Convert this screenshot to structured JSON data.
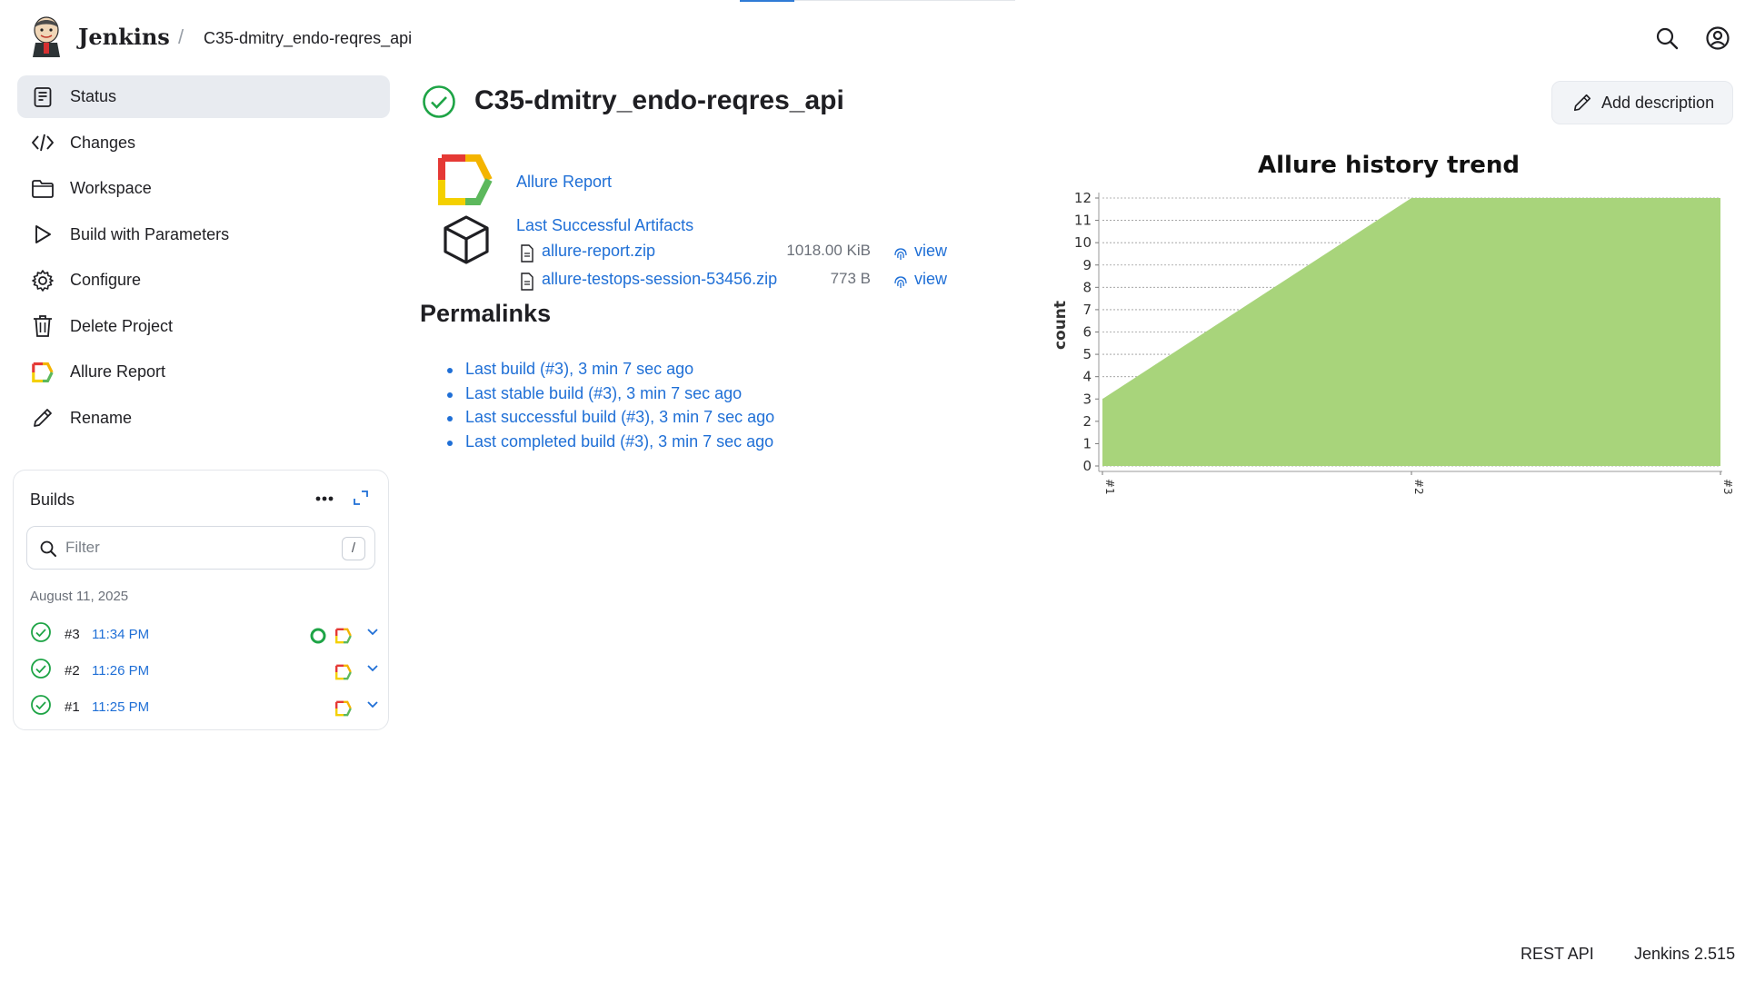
{
  "header": {
    "brand": "Jenkins",
    "breadcrumb_separator": "/",
    "breadcrumb_job": "C35-dmitry_endo-reqres_api",
    "icons": [
      "search-icon",
      "user-icon"
    ]
  },
  "sidebar": {
    "items": [
      {
        "label": "Status",
        "icon": "status-icon",
        "active": true
      },
      {
        "label": "Changes",
        "icon": "code-icon"
      },
      {
        "label": "Workspace",
        "icon": "folder-icon"
      },
      {
        "label": "Build with Parameters",
        "icon": "play-icon"
      },
      {
        "label": "Configure",
        "icon": "gear-icon"
      },
      {
        "label": "Delete Project",
        "icon": "trash-icon"
      },
      {
        "label": "Allure Report",
        "icon": "allure-icon"
      },
      {
        "label": "Rename",
        "icon": "pencil-icon"
      }
    ]
  },
  "builds": {
    "title": "Builds",
    "filter_placeholder": "Filter",
    "filter_shortcut": "/",
    "date": "August 11, 2025",
    "rows": [
      {
        "number": "#3",
        "time": "11:34 PM",
        "status": "success",
        "has_console": true
      },
      {
        "number": "#2",
        "time": "11:26 PM",
        "status": "success",
        "has_console": false
      },
      {
        "number": "#1",
        "time": "11:25 PM",
        "status": "success",
        "has_console": false
      }
    ]
  },
  "main": {
    "title": "C35-dmitry_endo-reqres_api",
    "status": "success",
    "add_description": "Add description",
    "allure_link": "Allure Report",
    "artifacts_link": "Last Successful Artifacts",
    "artifacts": [
      {
        "name": "allure-report.zip",
        "size": "1018.00 KiB",
        "view": "view"
      },
      {
        "name": "allure-testops-session-53456.zip",
        "size": "773 B",
        "view": "view"
      }
    ],
    "permalinks_title": "Permalinks",
    "permalinks": [
      "Last build (#3), 3 min 7 sec ago",
      "Last stable build (#3), 3 min 7 sec ago",
      "Last successful build (#3), 3 min 7 sec ago",
      "Last completed build (#3), 3 min 7 sec ago"
    ]
  },
  "chart_data": {
    "type": "area",
    "title": "Allure history trend",
    "ylabel": "count",
    "xlabel": "",
    "x": [
      "#1",
      "#2",
      "#3"
    ],
    "series": [
      {
        "values": [
          3,
          12,
          12
        ],
        "color": "#a8d47b"
      }
    ],
    "ylim": [
      0,
      12
    ],
    "yticks": [
      0,
      1,
      2,
      3,
      4,
      5,
      6,
      7,
      8,
      9,
      10,
      11,
      12
    ],
    "grid": true
  },
  "footer": {
    "rest_api": "REST API",
    "version": "Jenkins 2.515"
  },
  "colors": {
    "accent": "#1f6fd6",
    "success": "#1ea446",
    "chart_fill": "#a8d47b"
  }
}
